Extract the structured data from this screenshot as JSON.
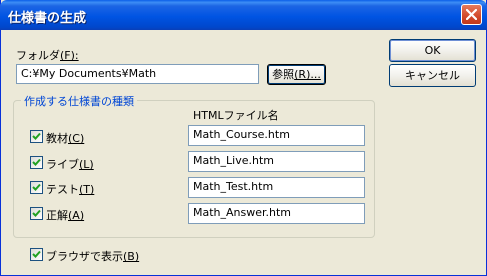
{
  "window": {
    "title": "仕様書の生成"
  },
  "folder": {
    "label": "フォルダ",
    "accel": "(F):",
    "value": "C:¥My Documents¥Math",
    "browse_label": "参照",
    "browse_accel": "(R)..."
  },
  "buttons": {
    "ok": "OK",
    "cancel": "キャンセル"
  },
  "group": {
    "title": "作成する仕様書の種類",
    "column_header": "HTMLファイル名"
  },
  "specs": [
    {
      "label": "教材",
      "accel": "(C)",
      "checked": true,
      "filename": "Math_Course.htm"
    },
    {
      "label": "ライブ",
      "accel": "(L)",
      "checked": true,
      "filename": "Math_Live.htm"
    },
    {
      "label": "テスト",
      "accel": "(T)",
      "checked": true,
      "filename": "Math_Test.htm"
    },
    {
      "label": "正解",
      "accel": "(A)",
      "checked": true,
      "filename": "Math_Answer.htm"
    }
  ],
  "browser": {
    "label": "ブラウザで表示",
    "accel": "(B)",
    "checked": true
  },
  "colors": {
    "titlebar": "#0054E3",
    "close_button": "#D2492A",
    "dialog_bg": "#ECE9D8",
    "group_title": "#0046D5",
    "check_mark": "#21A121"
  },
  "icons": {
    "close": "close-icon",
    "check": "checkmark-icon"
  }
}
